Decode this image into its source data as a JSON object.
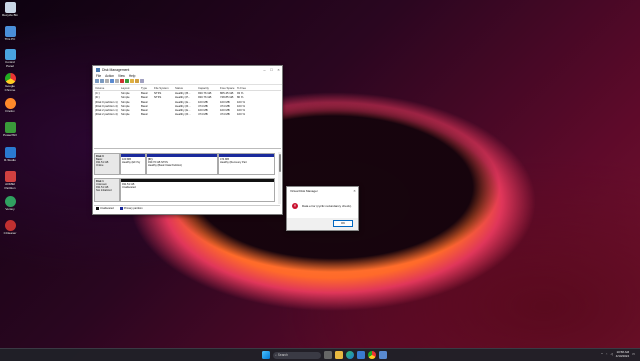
{
  "desktop": {
    "icons": [
      {
        "label": "Recycle Bin",
        "color": "#c9d6e6"
      },
      {
        "label": "This PC",
        "color": "#4a8fd9"
      },
      {
        "label": "Control Panel",
        "color": "#4aa3e0"
      },
      {
        "label": "Google Chrome",
        "color": "#e8a33a"
      },
      {
        "label": "Firefox",
        "color": "#ff8a2a"
      },
      {
        "label": "PowerISO",
        "color": "#3a9a3a"
      },
      {
        "label": "R-Studio",
        "color": "#2a7ad0"
      },
      {
        "label": "AOMEI Partition",
        "color": "#d04040"
      },
      {
        "label": "Ventoy",
        "color": "#30a060"
      },
      {
        "label": "CCleaner",
        "color": "#c03030"
      }
    ]
  },
  "disk_window": {
    "title": "Disk Management",
    "menu": [
      "File",
      "Action",
      "View",
      "Help"
    ],
    "columns": [
      "Volume",
      "Layout",
      "Type",
      "File System",
      "Status",
      "Capacity",
      "Free Space",
      "% Free"
    ],
    "rows": [
      [
        "(C:)",
        "Simple",
        "Basic",
        "NTFS",
        "Healthy (B...",
        "930.76 GB",
        "865.45 GB",
        "93 %"
      ],
      [
        "(D:)",
        "Simple",
        "Basic",
        "NTFS",
        "Healthy (P...",
        "930.76 GB",
        "748.85 GB",
        "80 %"
      ],
      [
        "(Disk 0 partition 1)",
        "Simple",
        "Basic",
        "",
        "Healthy (E...",
        "100 MB",
        "100 MB",
        "100 %"
      ],
      [
        "(Disk 0 partition 4)",
        "Simple",
        "Basic",
        "",
        "Healthy (R...",
        "474 MB",
        "474 MB",
        "100 %"
      ],
      [
        "(Disk 2 partition 1)",
        "Simple",
        "Basic",
        "",
        "Healthy (E...",
        "100 MB",
        "100 MB",
        "100 %"
      ],
      [
        "(Disk 2 partition 4)",
        "Simple",
        "Basic",
        "",
        "Healthy (R...",
        "474 MB",
        "474 MB",
        "100 %"
      ]
    ],
    "disk0": {
      "label": [
        "Disk 0",
        "Basic",
        "931.51 GB",
        "Online"
      ],
      "partitions": [
        {
          "l1": "",
          "l2": "100 MB",
          "l3": "Healthy (EFI Sy"
        },
        {
          "l1": "(D:)",
          "l2": "930.76 GB NTFS",
          "l3": "Healthy (Basic Data Partition)"
        },
        {
          "l1": "",
          "l2": "474 MB",
          "l3": "Healthy (Recovery Part"
        }
      ]
    },
    "disk1": {
      "label": [
        "Disk 1",
        "Unknown",
        "931.51 GB",
        "Not Initialized"
      ],
      "unalloc": {
        "l1": "931.51 GB",
        "l2": "Unallocated"
      }
    },
    "legend": [
      "Unallocated",
      "Primary partition"
    ]
  },
  "dialog": {
    "title": "Virtual Disk Manager",
    "message": "Data error (cyclic redundancy check).",
    "ok": "OK"
  },
  "taskbar": {
    "search": "Search",
    "time": "10:58 AM",
    "date": "4/10/2024"
  }
}
